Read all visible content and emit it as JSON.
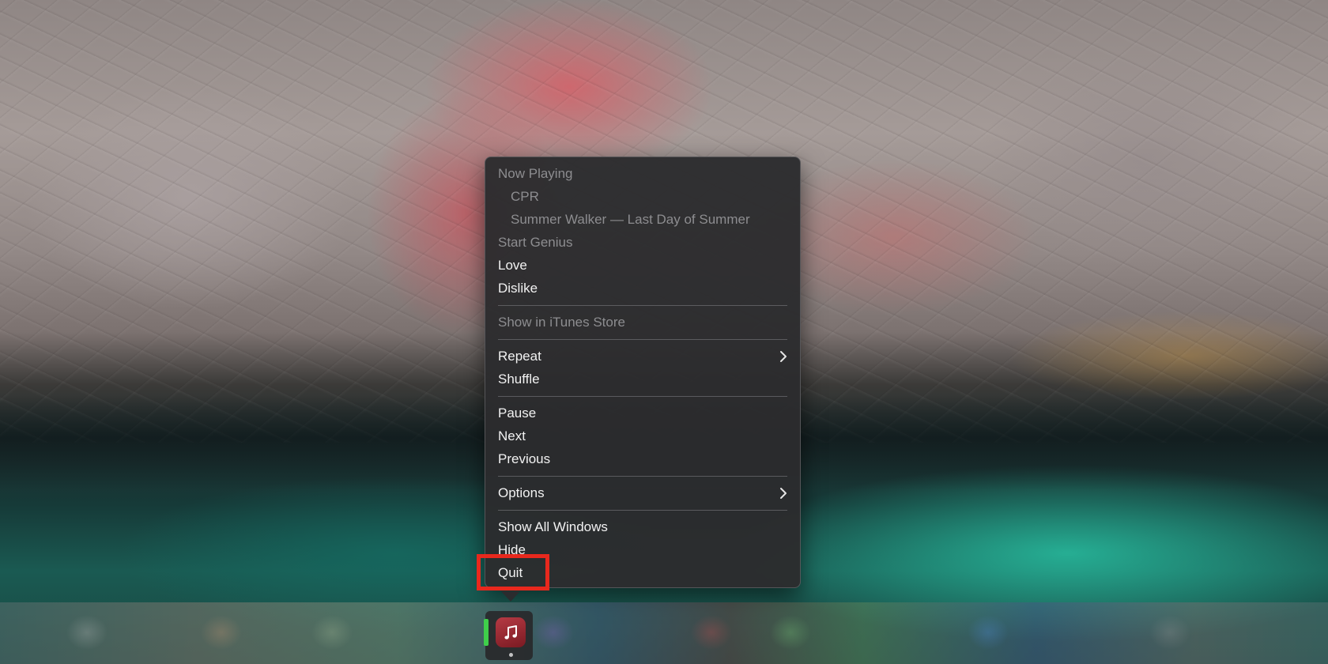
{
  "menu": {
    "items": [
      {
        "label": "Now Playing",
        "enabled": false
      },
      {
        "label": "CPR",
        "enabled": false
      },
      {
        "label": "Summer Walker — Last Day of Summer",
        "enabled": false
      },
      {
        "label": "Start Genius",
        "enabled": false
      },
      {
        "label": "Love",
        "enabled": true
      },
      {
        "label": "Dislike",
        "enabled": true
      },
      {
        "label": "Show in iTunes Store",
        "enabled": false
      },
      {
        "label": "Repeat",
        "enabled": true,
        "submenu": true
      },
      {
        "label": "Shuffle",
        "enabled": true
      },
      {
        "label": "Pause",
        "enabled": true
      },
      {
        "label": "Next",
        "enabled": true
      },
      {
        "label": "Previous",
        "enabled": true
      },
      {
        "label": "Options",
        "enabled": true,
        "submenu": true
      },
      {
        "label": "Show All Windows",
        "enabled": true
      },
      {
        "label": "Hide",
        "enabled": true
      },
      {
        "label": "Quit",
        "enabled": true,
        "highlighted": true
      }
    ]
  },
  "dock": {
    "active_app_icon": "music-icon"
  },
  "colors": {
    "menu_background": "#2c2c2e",
    "menu_text": "#f2f2f2",
    "menu_text_disabled": "#8d8d90",
    "highlight_border": "#e8281d",
    "music_icon": "#b63a44"
  }
}
